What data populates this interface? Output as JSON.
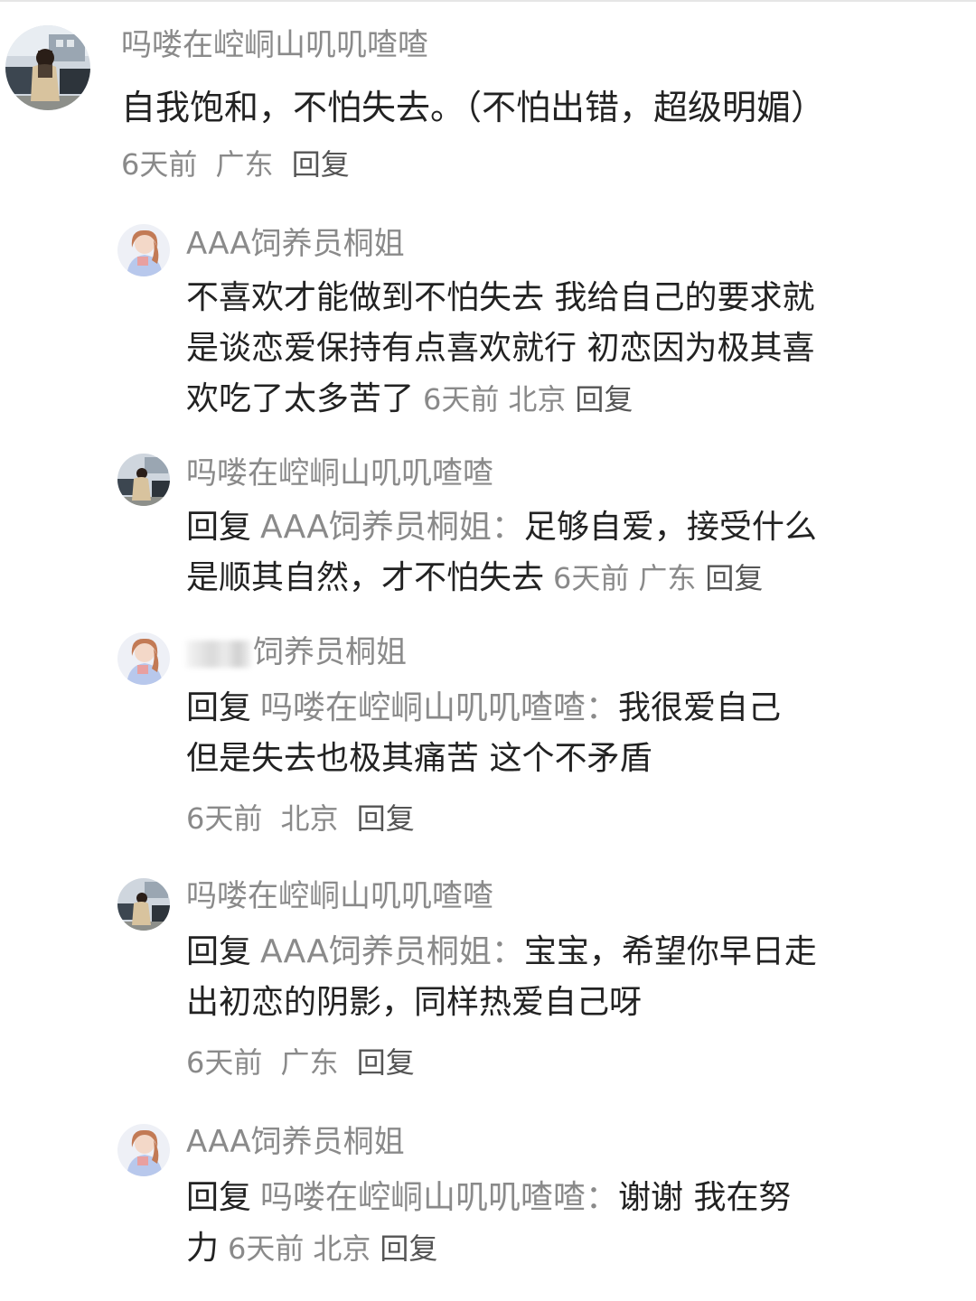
{
  "main_comment": {
    "username": "吗喽在崆峒山叽叽喳喳",
    "text": "自我饱和，不怕失去。（不怕出错，超级明媚）",
    "time": "6天前",
    "location": "广东",
    "reply_label": "回复"
  },
  "replies": [
    {
      "username": "AAA饲养员桐姐",
      "lines": [
        "不喜欢才能做到不怕失去 我给自己的要求就",
        "是谈恋爱保持有点喜欢就行 初恋因为极其喜",
        "欢吃了太多苦了"
      ],
      "time": "6天前",
      "location": "北京",
      "reply_label": "回复"
    },
    {
      "username": "吗喽在崆峒山叽叽喳喳",
      "reply_prefix": "回复",
      "reply_to": "AAA饲养员桐姐：",
      "lines": [
        "足够自爱，接受什么",
        "是顺其自然，才不怕失去"
      ],
      "time": "6天前",
      "location": "广东",
      "reply_label": "回复"
    },
    {
      "username": "饲养员桐姐",
      "reply_prefix": "回复",
      "reply_to": "吗喽在崆峒山叽叽喳喳：",
      "lines": [
        "我很爱自己",
        "但是失去也极其痛苦 这个不矛盾"
      ],
      "time": "6天前",
      "location": "北京",
      "reply_label": "回复"
    },
    {
      "username": "吗喽在崆峒山叽叽喳喳",
      "reply_prefix": "回复",
      "reply_to": "AAA饲养员桐姐：",
      "lines": [
        "宝宝，希望你早日走",
        "出初恋的阴影，同样热爱自己呀"
      ],
      "time": "6天前",
      "location": "广东",
      "reply_label": "回复"
    },
    {
      "username": "AAA饲养员桐姐",
      "reply_prefix": "回复",
      "reply_to": "吗喽在崆峒山叽叽喳喳：",
      "lines": [
        "谢谢 我在努",
        "力"
      ],
      "time": "6天前",
      "location": "北京",
      "reply_label": "回复"
    }
  ]
}
